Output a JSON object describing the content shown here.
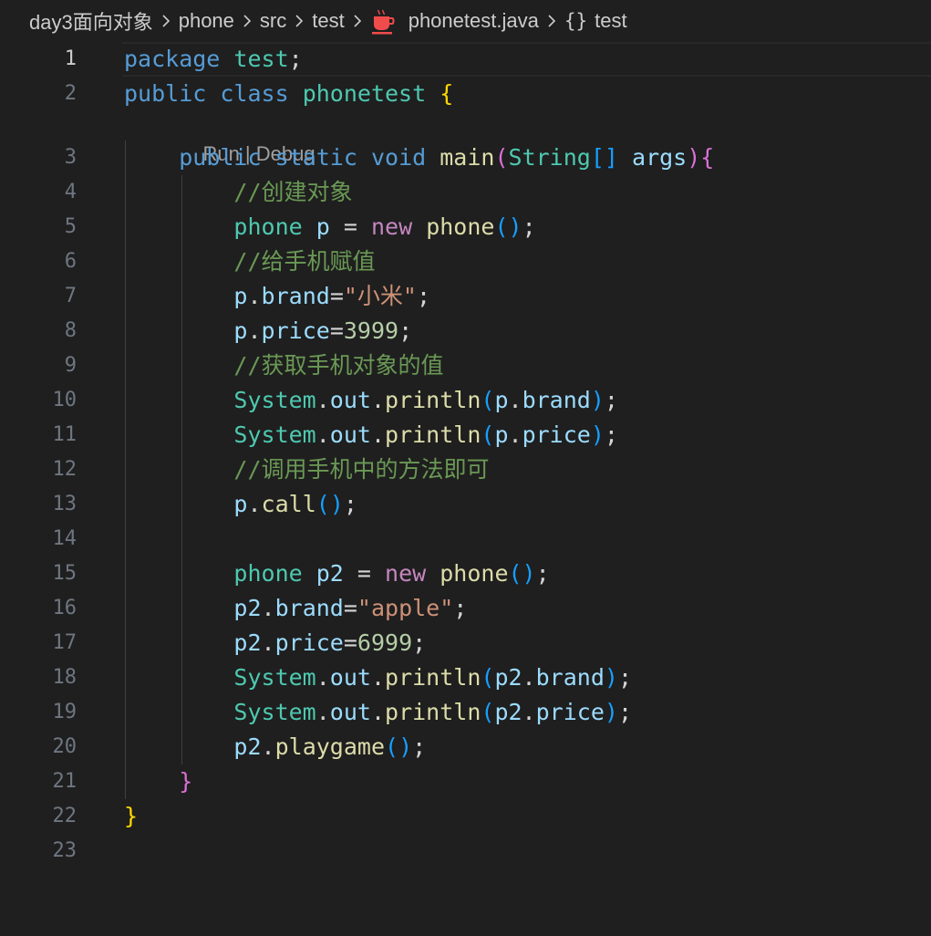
{
  "breadcrumb": {
    "items": [
      "day3面向对象",
      "phone",
      "src",
      "test",
      "phonetest.java",
      "test"
    ]
  },
  "codelens": {
    "run": "Run",
    "separator": " | ",
    "debug": "Debug"
  },
  "editor": {
    "active_line": 1,
    "lines": [
      {
        "n": "1",
        "tokens": [
          [
            "k",
            "package"
          ],
          [
            "p",
            " "
          ],
          [
            "t",
            "test"
          ],
          [
            "p",
            ";"
          ]
        ]
      },
      {
        "n": "2",
        "tokens": [
          [
            "k",
            "public"
          ],
          [
            "p",
            " "
          ],
          [
            "k",
            "class"
          ],
          [
            "p",
            " "
          ],
          [
            "t",
            "phonetest"
          ],
          [
            "p",
            " "
          ],
          [
            "b1",
            "{"
          ]
        ]
      },
      {
        "n": "3",
        "tokens": [
          [
            "p",
            "    "
          ],
          [
            "k",
            "public"
          ],
          [
            "p",
            " "
          ],
          [
            "k",
            "static"
          ],
          [
            "p",
            " "
          ],
          [
            "k",
            "void"
          ],
          [
            "p",
            " "
          ],
          [
            "f",
            "main"
          ],
          [
            "b2",
            "("
          ],
          [
            "t",
            "String"
          ],
          [
            "b3",
            "[]"
          ],
          [
            "p",
            " "
          ],
          [
            "v",
            "args"
          ],
          [
            "b2",
            ")"
          ],
          [
            "b2",
            "{"
          ]
        ]
      },
      {
        "n": "4",
        "tokens": [
          [
            "p",
            "        "
          ],
          [
            "c",
            "//创建对象"
          ]
        ]
      },
      {
        "n": "5",
        "tokens": [
          [
            "p",
            "        "
          ],
          [
            "t",
            "phone"
          ],
          [
            "p",
            " "
          ],
          [
            "v",
            "p"
          ],
          [
            "p",
            " = "
          ],
          [
            "kw2",
            "new"
          ],
          [
            "p",
            " "
          ],
          [
            "f",
            "phone"
          ],
          [
            "b3",
            "()"
          ],
          [
            "p",
            ";"
          ]
        ]
      },
      {
        "n": "6",
        "tokens": [
          [
            "p",
            "        "
          ],
          [
            "c",
            "//给手机赋值"
          ]
        ]
      },
      {
        "n": "7",
        "tokens": [
          [
            "p",
            "        "
          ],
          [
            "v",
            "p"
          ],
          [
            "p",
            "."
          ],
          [
            "v",
            "brand"
          ],
          [
            "p",
            "="
          ],
          [
            "s",
            "\"小米\""
          ],
          [
            "p",
            ";"
          ]
        ]
      },
      {
        "n": "8",
        "tokens": [
          [
            "p",
            "        "
          ],
          [
            "v",
            "p"
          ],
          [
            "p",
            "."
          ],
          [
            "v",
            "price"
          ],
          [
            "p",
            "="
          ],
          [
            "n",
            "3999"
          ],
          [
            "p",
            ";"
          ]
        ]
      },
      {
        "n": "9",
        "tokens": [
          [
            "p",
            "        "
          ],
          [
            "c",
            "//获取手机对象的值"
          ]
        ]
      },
      {
        "n": "10",
        "tokens": [
          [
            "p",
            "        "
          ],
          [
            "t",
            "System"
          ],
          [
            "p",
            "."
          ],
          [
            "v",
            "out"
          ],
          [
            "p",
            "."
          ],
          [
            "f",
            "println"
          ],
          [
            "b3",
            "("
          ],
          [
            "v",
            "p"
          ],
          [
            "p",
            "."
          ],
          [
            "v",
            "brand"
          ],
          [
            "b3",
            ")"
          ],
          [
            "p",
            ";"
          ]
        ]
      },
      {
        "n": "11",
        "tokens": [
          [
            "p",
            "        "
          ],
          [
            "t",
            "System"
          ],
          [
            "p",
            "."
          ],
          [
            "v",
            "out"
          ],
          [
            "p",
            "."
          ],
          [
            "f",
            "println"
          ],
          [
            "b3",
            "("
          ],
          [
            "v",
            "p"
          ],
          [
            "p",
            "."
          ],
          [
            "v",
            "price"
          ],
          [
            "b3",
            ")"
          ],
          [
            "p",
            ";"
          ]
        ]
      },
      {
        "n": "12",
        "tokens": [
          [
            "p",
            "        "
          ],
          [
            "c",
            "//调用手机中的方法即可"
          ]
        ]
      },
      {
        "n": "13",
        "tokens": [
          [
            "p",
            "        "
          ],
          [
            "v",
            "p"
          ],
          [
            "p",
            "."
          ],
          [
            "f",
            "call"
          ],
          [
            "b3",
            "()"
          ],
          [
            "p",
            ";"
          ]
        ]
      },
      {
        "n": "14",
        "tokens": []
      },
      {
        "n": "15",
        "tokens": [
          [
            "p",
            "        "
          ],
          [
            "t",
            "phone"
          ],
          [
            "p",
            " "
          ],
          [
            "v",
            "p2"
          ],
          [
            "p",
            " = "
          ],
          [
            "kw2",
            "new"
          ],
          [
            "p",
            " "
          ],
          [
            "f",
            "phone"
          ],
          [
            "b3",
            "()"
          ],
          [
            "p",
            ";"
          ]
        ]
      },
      {
        "n": "16",
        "tokens": [
          [
            "p",
            "        "
          ],
          [
            "v",
            "p2"
          ],
          [
            "p",
            "."
          ],
          [
            "v",
            "brand"
          ],
          [
            "p",
            "="
          ],
          [
            "s",
            "\"apple\""
          ],
          [
            "p",
            ";"
          ]
        ]
      },
      {
        "n": "17",
        "tokens": [
          [
            "p",
            "        "
          ],
          [
            "v",
            "p2"
          ],
          [
            "p",
            "."
          ],
          [
            "v",
            "price"
          ],
          [
            "p",
            "="
          ],
          [
            "n",
            "6999"
          ],
          [
            "p",
            ";"
          ]
        ]
      },
      {
        "n": "18",
        "tokens": [
          [
            "p",
            "        "
          ],
          [
            "t",
            "System"
          ],
          [
            "p",
            "."
          ],
          [
            "v",
            "out"
          ],
          [
            "p",
            "."
          ],
          [
            "f",
            "println"
          ],
          [
            "b3",
            "("
          ],
          [
            "v",
            "p2"
          ],
          [
            "p",
            "."
          ],
          [
            "v",
            "brand"
          ],
          [
            "b3",
            ")"
          ],
          [
            "p",
            ";"
          ]
        ]
      },
      {
        "n": "19",
        "tokens": [
          [
            "p",
            "        "
          ],
          [
            "t",
            "System"
          ],
          [
            "p",
            "."
          ],
          [
            "v",
            "out"
          ],
          [
            "p",
            "."
          ],
          [
            "f",
            "println"
          ],
          [
            "b3",
            "("
          ],
          [
            "v",
            "p2"
          ],
          [
            "p",
            "."
          ],
          [
            "v",
            "price"
          ],
          [
            "b3",
            ")"
          ],
          [
            "p",
            ";"
          ]
        ]
      },
      {
        "n": "20",
        "tokens": [
          [
            "p",
            "        "
          ],
          [
            "v",
            "p2"
          ],
          [
            "p",
            "."
          ],
          [
            "f",
            "playgame"
          ],
          [
            "b3",
            "()"
          ],
          [
            "p",
            ";"
          ]
        ]
      },
      {
        "n": "21",
        "tokens": [
          [
            "p",
            "    "
          ],
          [
            "b2",
            "}"
          ]
        ]
      },
      {
        "n": "22",
        "tokens": [
          [
            "b1",
            "}"
          ]
        ]
      },
      {
        "n": "23",
        "tokens": []
      }
    ]
  },
  "colors": {
    "background": "#1f1f1f",
    "keyword": "#569cd6",
    "type": "#4ec9b0",
    "function": "#dcdcaa",
    "variable": "#9cdcfe",
    "string": "#ce9178",
    "number": "#b5cea8",
    "comment": "#6a9955",
    "control_keyword": "#c586c0",
    "bracket_level1": "#ffd700",
    "bracket_level2": "#da70d6",
    "bracket_level3": "#179fff",
    "java_icon": "#f14c4c"
  },
  "icons": {
    "breadcrumb_separator": "chevron-right-icon",
    "file_type": "java-coffee-cup-icon",
    "symbol": "curly-braces-icon"
  }
}
